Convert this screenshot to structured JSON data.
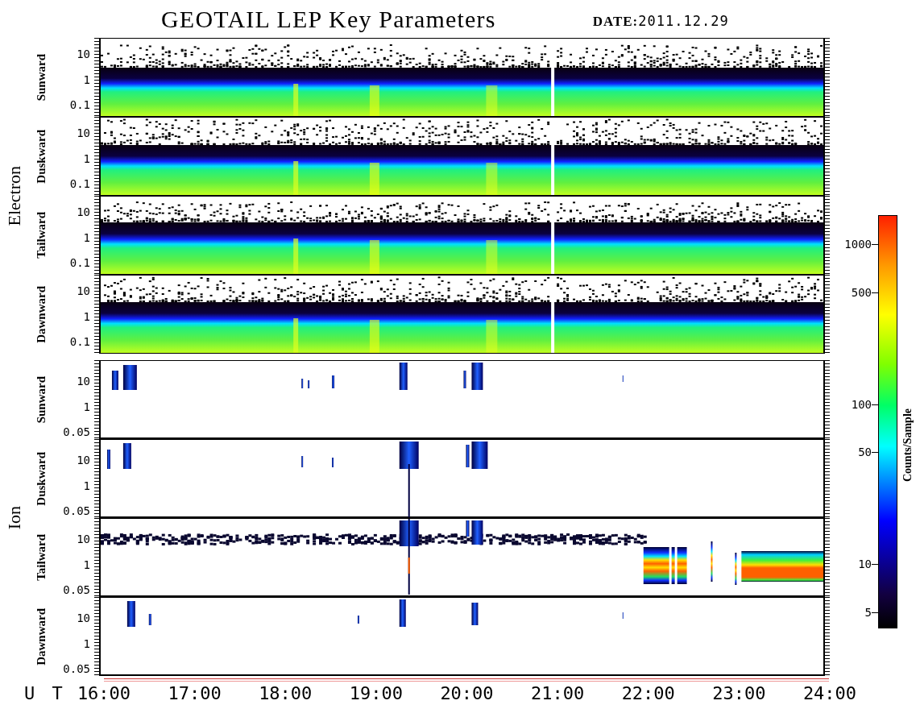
{
  "title": "GEOTAIL LEP Key Parameters",
  "date": "**DATE:**2011.12.29",
  "groups": [
    {
      "label": "Electron",
      "kind": "electron",
      "panels": [
        {
          "label": "Sunward",
          "yticks": [
            "10",
            "1",
            "0.1"
          ]
        },
        {
          "label": "Duskward",
          "yticks": [
            "10",
            "1",
            "0.1"
          ]
        },
        {
          "label": "Tailward",
          "yticks": [
            "10",
            "1",
            "0.1"
          ]
        },
        {
          "label": "Dawnward",
          "yticks": [
            "10",
            "1",
            "0.1"
          ]
        }
      ]
    },
    {
      "label": "Ion",
      "kind": "ion",
      "panels": [
        {
          "label": "Sunward",
          "yticks": [
            "10",
            "1",
            "0.05"
          ]
        },
        {
          "label": "Duskward",
          "yticks": [
            "10",
            "1",
            "0.05"
          ]
        },
        {
          "label": "Tailward",
          "yticks": [
            "10",
            "1",
            "0.05"
          ]
        },
        {
          "label": "Dawnward",
          "yticks": [
            "10",
            "1",
            "0.05"
          ]
        }
      ]
    }
  ],
  "x_axis": {
    "label": "U T",
    "ticks": [
      "16:00",
      "17:00",
      "18:00",
      "19:00",
      "20:00",
      "21:00",
      "22:00",
      "23:00",
      "24:00"
    ]
  },
  "colorbar": {
    "label": "Counts/Sample",
    "ticks": [
      "1000",
      "500",
      "100",
      "50",
      "10",
      "5"
    ]
  }
}
